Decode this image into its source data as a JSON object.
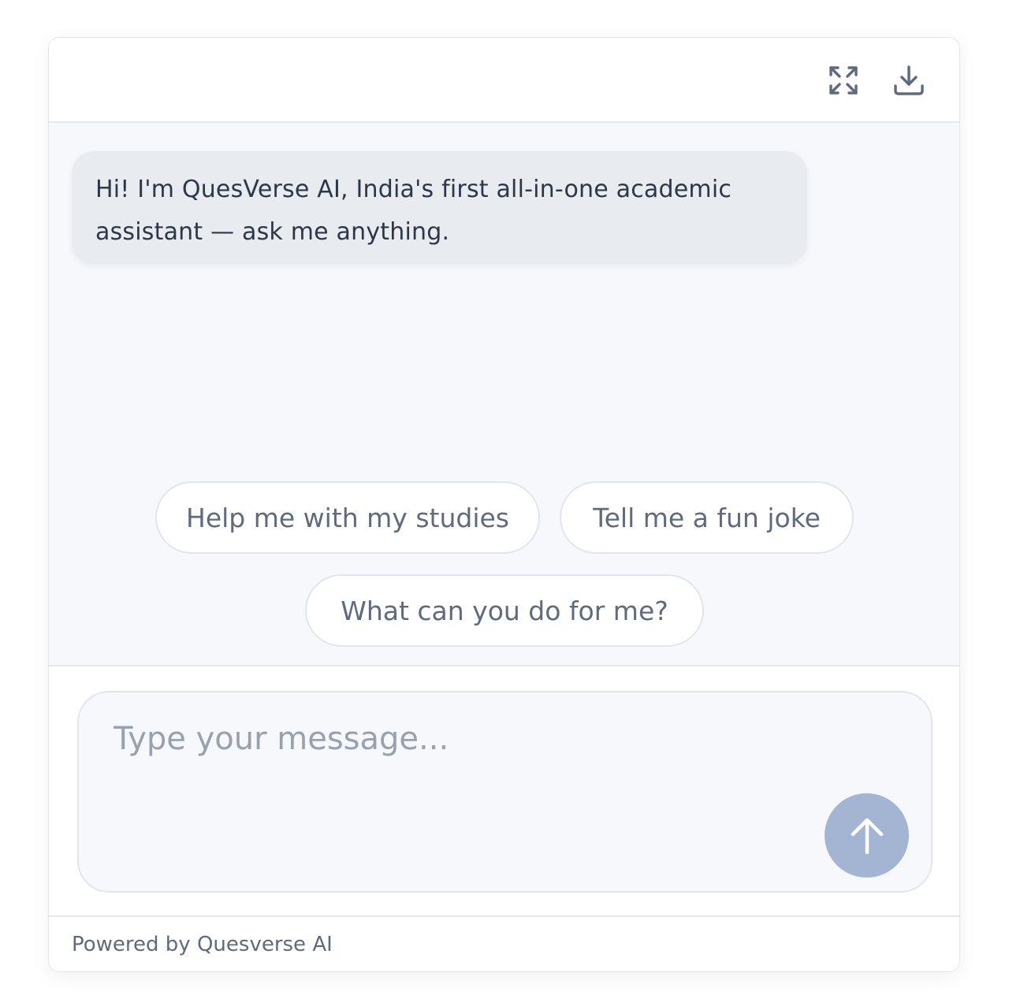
{
  "header": {
    "expand_icon": "expand-icon",
    "download_icon": "download-icon"
  },
  "messages": [
    {
      "role": "assistant",
      "text": "Hi! I'm QuesVerse AI, India's first all-in-one academic assistant — ask me anything."
    }
  ],
  "suggestions": [
    "Help me with my studies",
    "Tell me a fun joke",
    "What can you do for me?"
  ],
  "composer": {
    "placeholder": "Type your message...",
    "value": "",
    "send_icon": "arrow-up-icon"
  },
  "footer": {
    "text": "Powered by Quesverse AI"
  },
  "colors": {
    "send_button": "#a3b5d3",
    "bubble_bg": "#e8ebef",
    "panel_bg": "#f6f8fb",
    "text": "#2d3748",
    "muted_text": "#5f6b7d"
  }
}
